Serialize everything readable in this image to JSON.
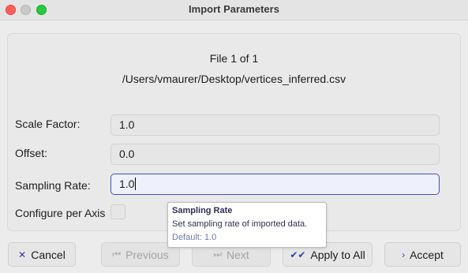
{
  "window": {
    "title": "Import Parameters"
  },
  "file": {
    "count_text": "File 1 of 1",
    "path": "/Users/vmaurer/Desktop/vertices_inferred.csv"
  },
  "fields": {
    "scale_factor": {
      "label": "Scale Factor:",
      "value": "1.0"
    },
    "offset": {
      "label": "Offset:",
      "value": "0.0"
    },
    "sampling_rate": {
      "label": "Sampling Rate:",
      "value": "1.0"
    }
  },
  "configure_per_axis": {
    "label": "Configure per Axis",
    "checked": false
  },
  "tooltip": {
    "title": "Sampling Rate",
    "description": "Set sampling rate of imported data.",
    "default_text": "Default: 1.0"
  },
  "buttons": {
    "cancel": {
      "label": "Cancel",
      "icon": "close-icon"
    },
    "previous": {
      "label": "Previous",
      "icon": "skip-previous-icon",
      "enabled": false
    },
    "next": {
      "label": "Next",
      "icon": "skip-next-icon",
      "enabled": false
    },
    "apply_all": {
      "label": "Apply to All",
      "icon": "double-check-icon"
    },
    "accept": {
      "label": "Accept",
      "icon": "chevron-right-icon"
    }
  },
  "colors": {
    "accent": "#4b4bc8",
    "close": "#ff5f57",
    "maximize": "#28c840"
  }
}
